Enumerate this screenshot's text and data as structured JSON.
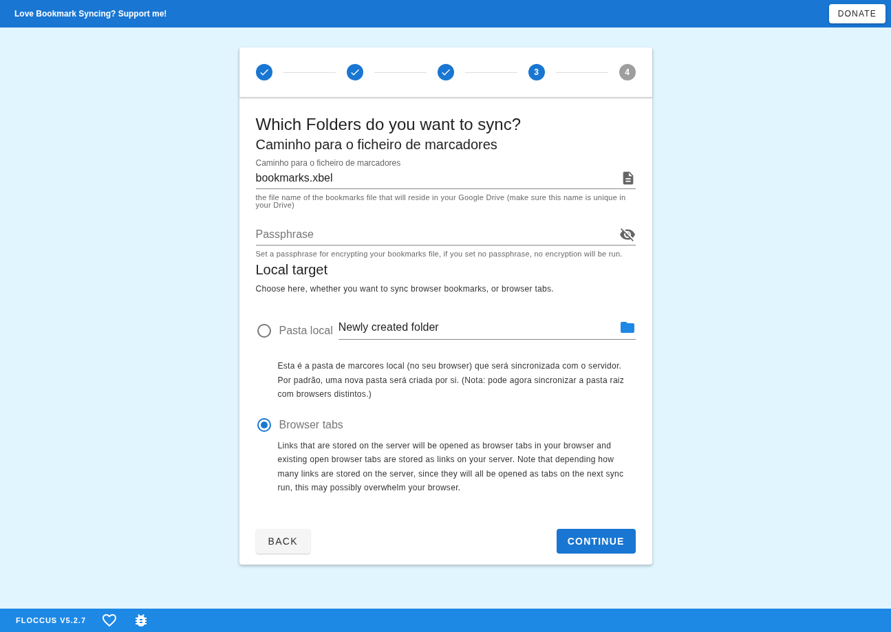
{
  "top_bar": {
    "message": "Love Bookmark Syncing? Support me!",
    "donate_button": "DONATE"
  },
  "stepper": [
    {
      "kind": "done"
    },
    {
      "kind": "done"
    },
    {
      "kind": "done"
    },
    {
      "kind": "active",
      "label": "3"
    },
    {
      "kind": "pending",
      "label": "4"
    }
  ],
  "title": "Which Folders do you want to sync?",
  "file_section": {
    "heading": "Caminho para o ficheiro de marcadores",
    "label": "Caminho para o ficheiro de marcadores",
    "value": "bookmarks.xbel",
    "hint": "the file name of the bookmarks file that will reside in your Google Drive (make sure this name is unique in your Drive)"
  },
  "passphrase": {
    "placeholder": "Passphrase",
    "hint": "Set a passphrase for encrypting your bookmarks file, if you set no passphrase, no encryption will be run."
  },
  "local_target": {
    "heading": "Local target",
    "description": "Choose here, whether you want to sync browser bookmarks, or browser tabs.",
    "options": [
      {
        "kind": "folder",
        "label": "Pasta local",
        "selected": false,
        "value": "Newly created folder",
        "description": "Esta é a pasta de marcores local (no seu browser) que será sincronizada com o servidor. Por padrão, uma nova pasta será criada por si. (Nota: pode agora sincronizar a pasta raiz com browsers distintos.)"
      },
      {
        "kind": "tabs",
        "label": "Browser tabs",
        "selected": true,
        "description": "Links that are stored on the server will be opened as browser tabs in your browser and existing open browser tabs are stored as links on your server. Note that depending how many links are stored on the server, since they will all be opened as tabs on the next sync run, this may possibly overwhelm your browser."
      }
    ]
  },
  "buttons": {
    "back": "BACK",
    "continue": "CONTINUE"
  },
  "footer": {
    "version": "FLOCCUS V5.2.7"
  }
}
